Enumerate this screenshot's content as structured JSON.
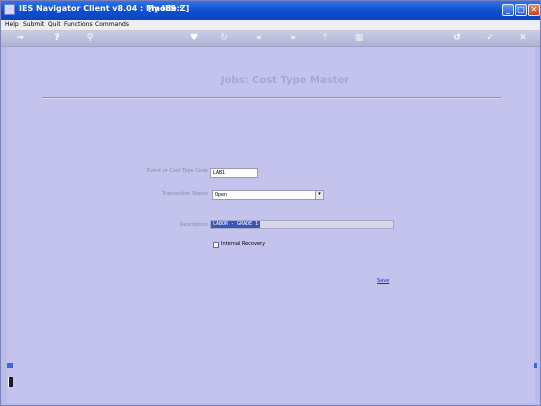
{
  "window": {
    "title": "IES Navigator Client v8.04 : My IES :",
    "mode": "[mode:Z]",
    "controls": [
      "_",
      "□",
      "✕"
    ]
  },
  "menu": {
    "items": [
      "Help",
      "Submit",
      "Quit",
      "Functions",
      "Commands"
    ]
  },
  "toolbar": {
    "icons": [
      "key-icon",
      "help-icon",
      "search-icon",
      "heart-icon",
      "refresh-icon",
      "rewind-icon",
      "fast-forward-icon",
      "up-arrow-icon",
      "grid-icon",
      "history-icon",
      "check-icon",
      "close-icon"
    ]
  },
  "form": {
    "title": "Jobs: Cost Type Master",
    "cost_type_code": {
      "label": "Event or Cost Type Code",
      "value": "LAB1"
    },
    "transaction_status": {
      "label": "Transaction Status",
      "value": "Open"
    },
    "description": {
      "label": "Description",
      "value": "LABOR - GRADE 1"
    },
    "internal_recovery": {
      "label": "Internal Recovery",
      "checked": false
    },
    "save_label": "Save"
  }
}
